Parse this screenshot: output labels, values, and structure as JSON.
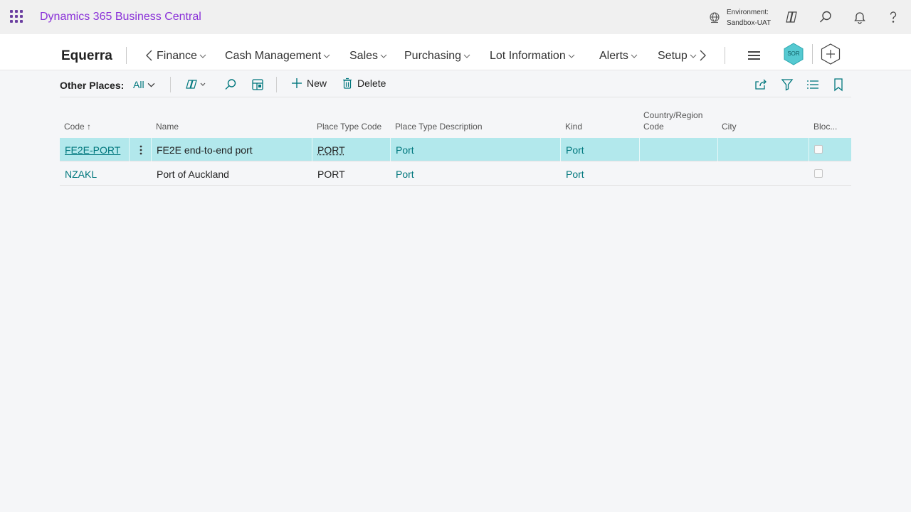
{
  "app": {
    "brand": "Dynamics 365 Business Central",
    "environment_label": "Environment:",
    "environment_value": "Sandbox-UAT"
  },
  "nav": {
    "company": "Equerra",
    "items": [
      "Finance",
      "Cash Management",
      "Sales",
      "Purchasing",
      "Lot Information",
      "Alerts",
      "Setup"
    ],
    "avatar_initials": "SOR"
  },
  "actions": {
    "other_places_label": "Other Places:",
    "filter_value": "All",
    "new_label": "New",
    "delete_label": "Delete"
  },
  "table": {
    "headers": {
      "code": "Code",
      "name": "Name",
      "place_type_code": "Place Type Code",
      "place_type_description": "Place Type Description",
      "kind": "Kind",
      "country_line1": "Country/Region",
      "country_line2": "Code",
      "city": "City",
      "blocked": "Bloc..."
    },
    "sort_indicator": "↑",
    "rows": [
      {
        "code": "FE2E-PORT",
        "name": "FE2E end-to-end port",
        "place_type_code": "PORT",
        "place_type_description": "Port",
        "kind": "Port",
        "country": "",
        "city": ""
      },
      {
        "code": "NZAKL",
        "name": "Port of Auckland",
        "place_type_code": "PORT",
        "place_type_description": "Port",
        "kind": "Port",
        "country": "",
        "city": ""
      }
    ]
  },
  "colors": {
    "brand": "#8a31d8",
    "accent": "#00777d",
    "selected_row": "#b2e8ec"
  }
}
